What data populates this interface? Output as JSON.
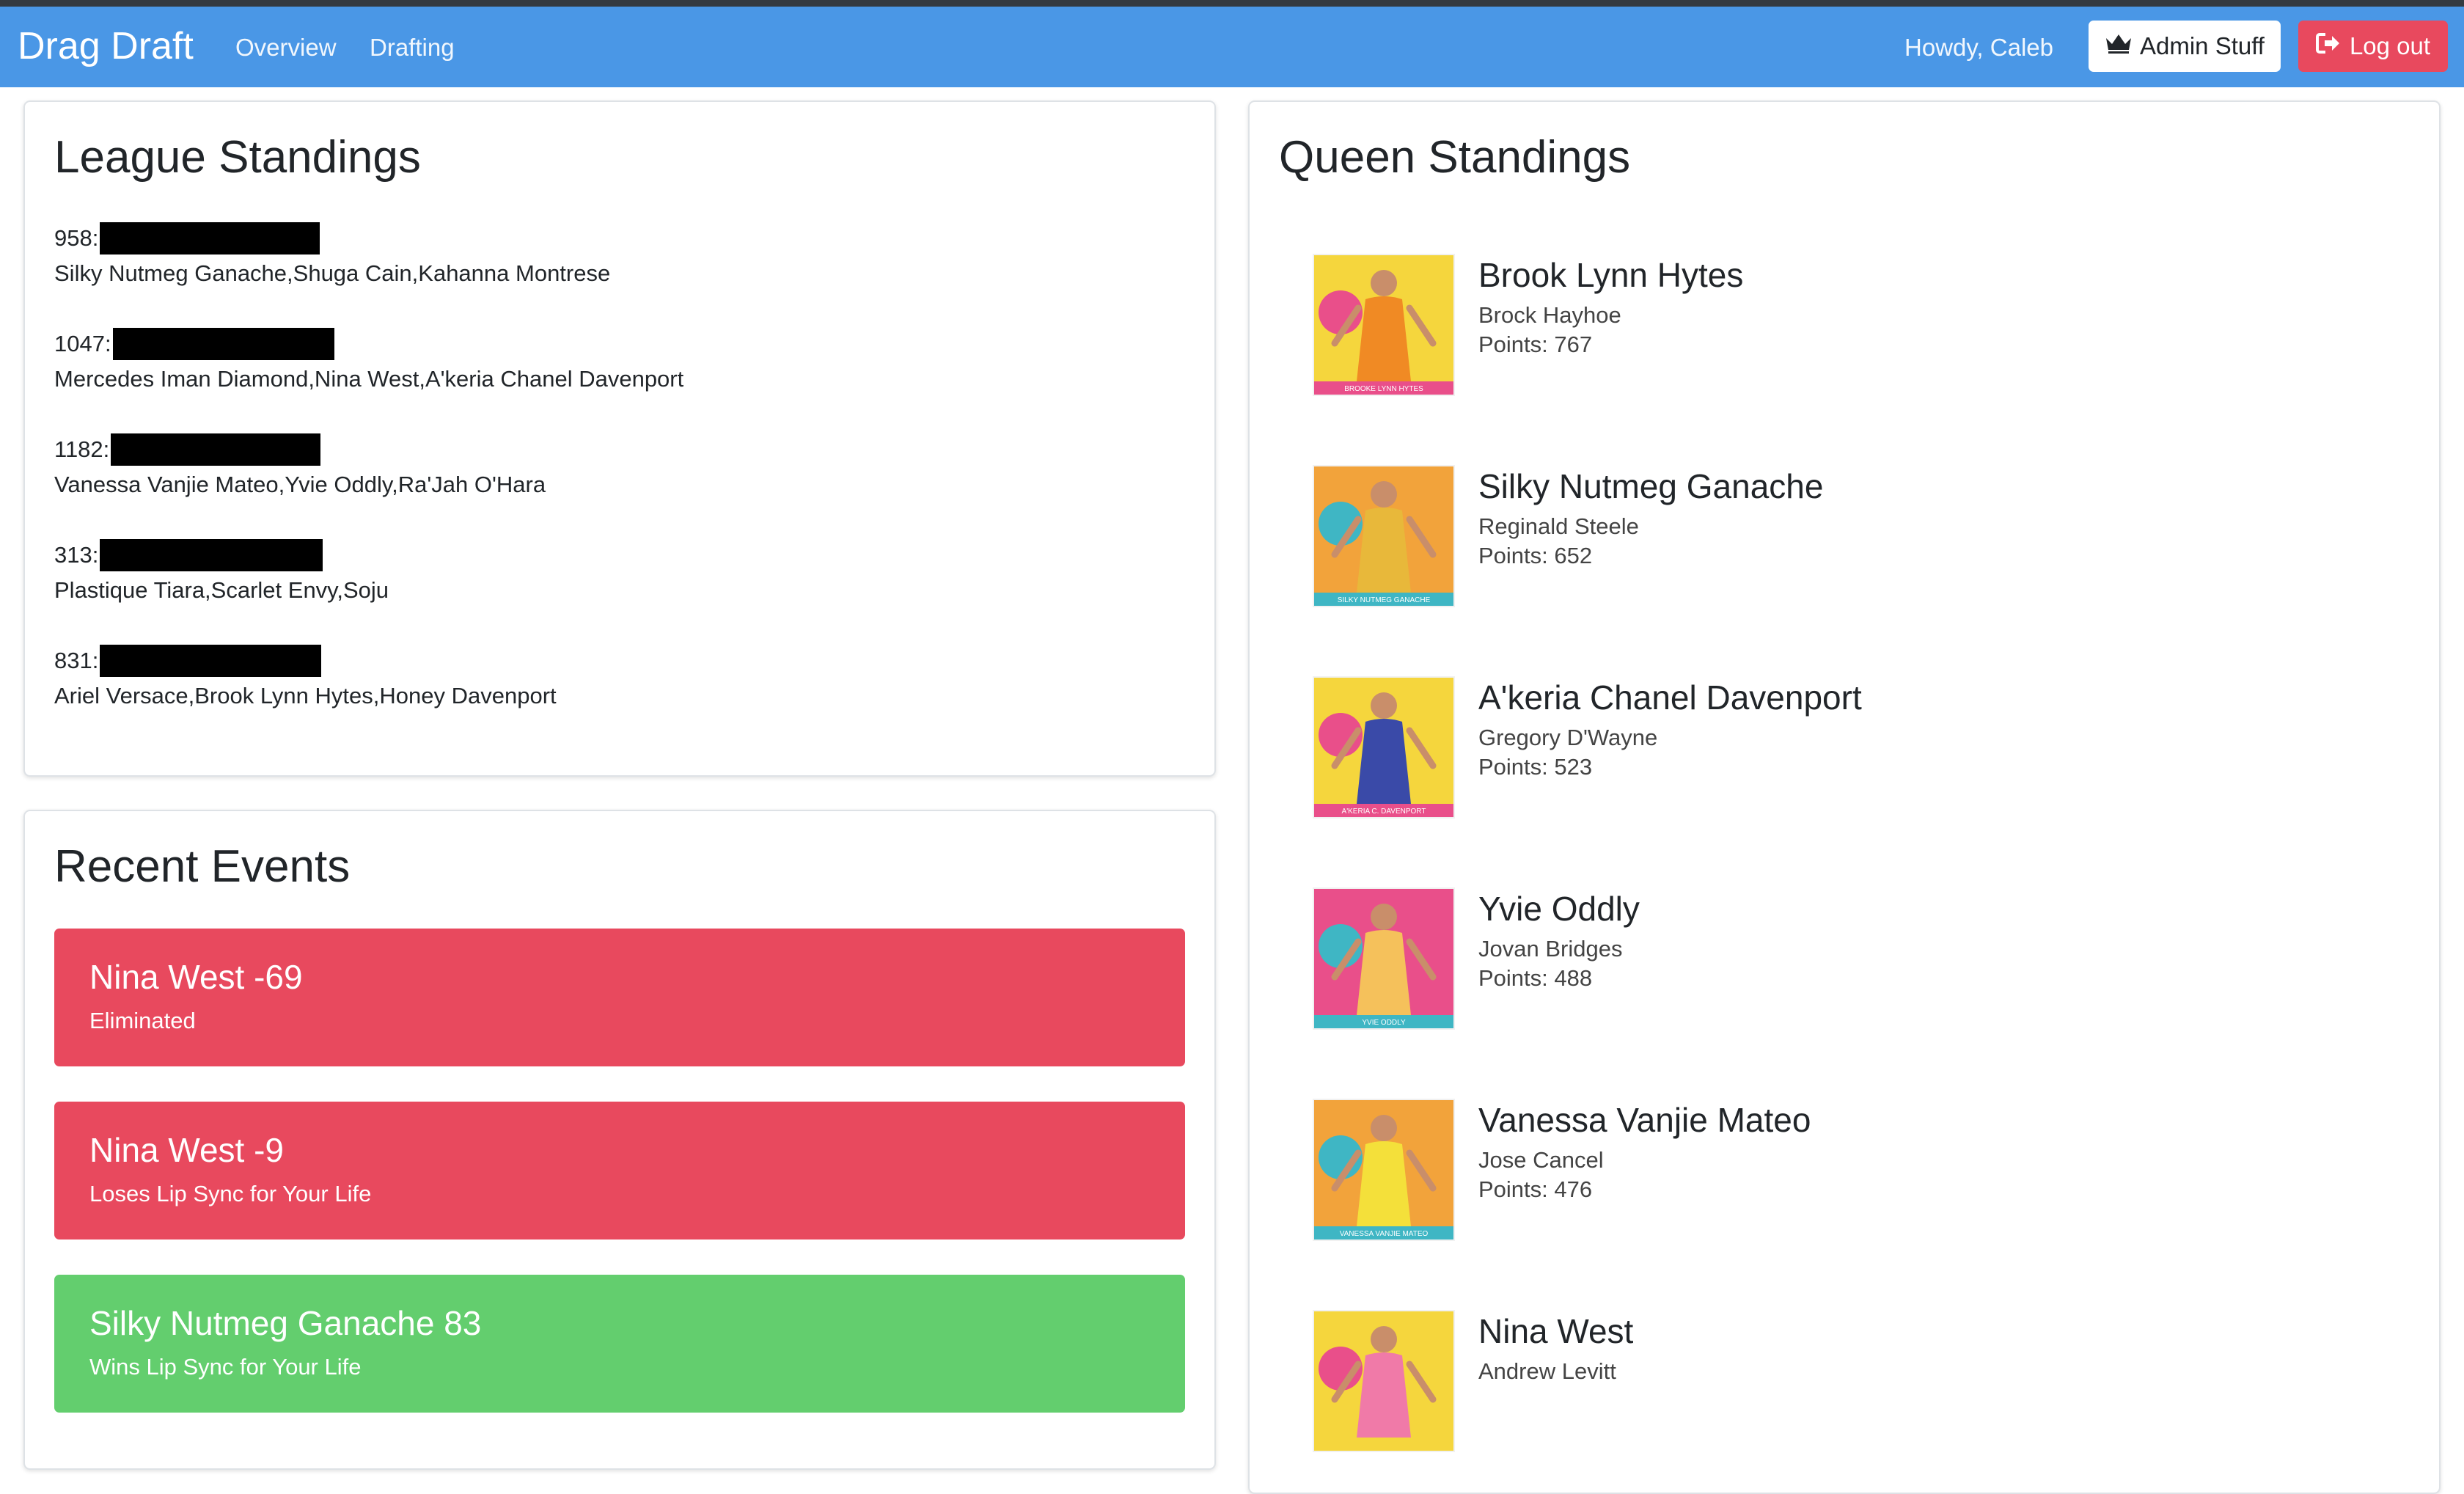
{
  "navbar": {
    "brand": "Drag Draft",
    "links": [
      "Overview",
      "Drafting"
    ],
    "greeting": "Howdy, Caleb",
    "admin_label": "Admin Stuff",
    "admin_icon": "crown-icon",
    "logout_label": "Log out",
    "logout_icon": "sign-out-icon",
    "colors": {
      "bar": "#4a97e6",
      "logout": "#e8495e"
    }
  },
  "league": {
    "title": "League Standings",
    "teams": [
      {
        "score": "958:",
        "members": "Silky Nutmeg Ganache,Shuga Cain,Kahanna Montrese"
      },
      {
        "score": "1047:",
        "members": "Mercedes Iman Diamond,Nina West,A'keria Chanel Davenport"
      },
      {
        "score": "1182:",
        "members": "Vanessa Vanjie Mateo,Yvie Oddly,Ra'Jah O'Hara"
      },
      {
        "score": "313:",
        "members": "Plastique Tiara,Scarlet Envy,Soju"
      },
      {
        "score": "831:",
        "members": "Ariel Versace,Brook Lynn Hytes,Honey Davenport"
      }
    ]
  },
  "events": {
    "title": "Recent Events",
    "items": [
      {
        "title": "Nina West -69",
        "subtitle": "Eliminated",
        "kind": "negative"
      },
      {
        "title": "Nina West -9",
        "subtitle": "Loses Lip Sync for Your Life",
        "kind": "negative"
      },
      {
        "title": "Silky Nutmeg Ganache 83",
        "subtitle": "Wins Lip Sync for Your Life",
        "kind": "positive"
      }
    ],
    "colors": {
      "negative": "#e8495e",
      "positive": "#63ce6e"
    }
  },
  "queens": {
    "title": "Queen Standings",
    "items": [
      {
        "name": "Brook Lynn Hytes",
        "real_name": "Brock Hayhoe",
        "points": "Points: 767",
        "image_caption": "BROOKE LYNN HYTES",
        "bg": "#f5d63d",
        "accent": "#e94f8a",
        "outfit": "#f08a24"
      },
      {
        "name": "Silky Nutmeg Ganache",
        "real_name": "Reginald Steele",
        "points": "Points: 652",
        "image_caption": "SILKY NUTMEG GANACHE",
        "bg": "#f2a33b",
        "accent": "#3fb6c4",
        "outfit": "#e8b83a"
      },
      {
        "name": "A'keria Chanel Davenport",
        "real_name": "Gregory D'Wayne",
        "points": "Points: 523",
        "image_caption": "A'KERIA C. DAVENPORT",
        "bg": "#f5d63d",
        "accent": "#e94f8a",
        "outfit": "#3a4aa8"
      },
      {
        "name": "Yvie Oddly",
        "real_name": "Jovan Bridges",
        "points": "Points: 488",
        "image_caption": "YVIE ODDLY",
        "bg": "#e94f8a",
        "accent": "#3fb6c4",
        "outfit": "#f5c15b"
      },
      {
        "name": "Vanessa Vanjie Mateo",
        "real_name": "Jose Cancel",
        "points": "Points: 476",
        "image_caption": "VANESSA VANJIE MATEO",
        "bg": "#f2a33b",
        "accent": "#3fb6c4",
        "outfit": "#f4e03a"
      },
      {
        "name": "Nina West",
        "real_name": "Andrew Levitt",
        "points": "",
        "image_caption": "",
        "bg": "#f5d63d",
        "accent": "#e94f8a",
        "outfit": "#f07aa8"
      }
    ]
  }
}
